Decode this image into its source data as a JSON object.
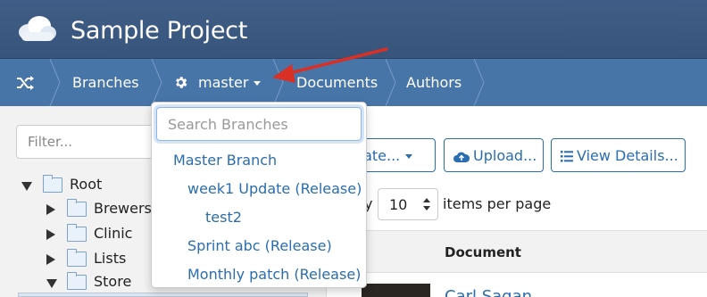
{
  "header": {
    "title": "Sample Project",
    "logo_icon": "cloud-icon"
  },
  "breadcrumb": {
    "items": [
      {
        "label": "",
        "icon": "shuffle-icon"
      },
      {
        "label": "Branches"
      },
      {
        "label": "master",
        "icon": "gear-icon"
      },
      {
        "label": "Documents"
      },
      {
        "label": "Authors"
      }
    ]
  },
  "branch_dropdown": {
    "search_placeholder": "Search Branches",
    "items": [
      {
        "label": "Master Branch",
        "level": 0
      },
      {
        "label": "week1 Update (Release)",
        "level": 1
      },
      {
        "label": "test2",
        "level": 2
      },
      {
        "label": "Sprint abc (Release)",
        "level": 1
      },
      {
        "label": "Monthly patch (Release)",
        "level": 1
      }
    ]
  },
  "sidebar": {
    "filter_placeholder": "Filter...",
    "tree": [
      {
        "label": "Root",
        "expanded": true
      },
      {
        "label": "Brewers",
        "expanded": false
      },
      {
        "label": "Clinic",
        "expanded": false
      },
      {
        "label": "Lists",
        "expanded": false
      },
      {
        "label": "Store",
        "expanded": true
      }
    ]
  },
  "toolbar": {
    "create_label": "reate...",
    "upload_label": "Upload...",
    "view_details_label": "View Details..."
  },
  "pagination": {
    "pre_text": "y",
    "per_page_value": "10",
    "post_text": "items per page"
  },
  "table": {
    "column_document": "Document",
    "rows": [
      {
        "name": "Carl Sagan"
      }
    ]
  },
  "colors": {
    "header_bg": "#3d5a80",
    "breadcrumb_bg": "#4775a8",
    "link_blue": "#2a6db0",
    "annotation_red": "#d93025"
  }
}
